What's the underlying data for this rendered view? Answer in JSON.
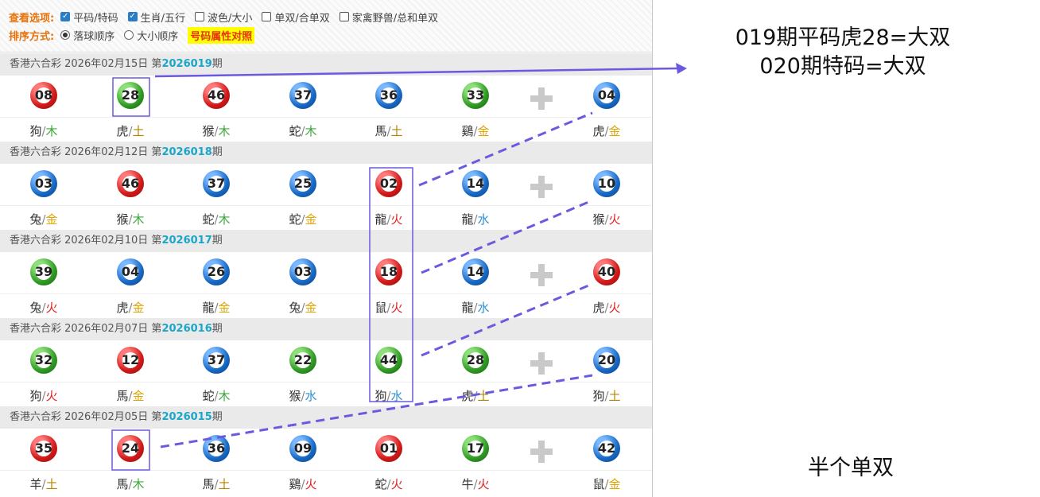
{
  "options": {
    "view_label": "查看选项:",
    "view_items": [
      {
        "label": "平码/特码",
        "checked": true
      },
      {
        "label": "生肖/五行",
        "checked": true
      },
      {
        "label": "波色/大小",
        "checked": false
      },
      {
        "label": "单双/合单双",
        "checked": false
      },
      {
        "label": "家禽野兽/总和单双",
        "checked": false
      }
    ],
    "sort_label": "排序方式:",
    "sort_items": [
      {
        "label": "落球顺序",
        "selected": true
      },
      {
        "label": "大小顺序",
        "selected": false
      }
    ],
    "attr_button": "号码属性对照"
  },
  "draws": [
    {
      "prefix": "香港六合彩 2026年02月15日 第",
      "issue": "2026019",
      "suffix": "期",
      "balls": [
        {
          "num": "08",
          "color": "red",
          "zodiac": "狗",
          "element": "木"
        },
        {
          "num": "28",
          "color": "green",
          "zodiac": "虎",
          "element": "土"
        },
        {
          "num": "46",
          "color": "red",
          "zodiac": "猴",
          "element": "木"
        },
        {
          "num": "37",
          "color": "blue",
          "zodiac": "蛇",
          "element": "木"
        },
        {
          "num": "36",
          "color": "blue",
          "zodiac": "馬",
          "element": "土"
        },
        {
          "num": "33",
          "color": "green",
          "zodiac": "鷄",
          "element": "金"
        },
        {
          "num": "04",
          "color": "blue",
          "zodiac": "虎",
          "element": "金"
        }
      ]
    },
    {
      "prefix": "香港六合彩 2026年02月12日 第",
      "issue": "2026018",
      "suffix": "期",
      "balls": [
        {
          "num": "03",
          "color": "blue",
          "zodiac": "兔",
          "element": "金"
        },
        {
          "num": "46",
          "color": "red",
          "zodiac": "猴",
          "element": "木"
        },
        {
          "num": "37",
          "color": "blue",
          "zodiac": "蛇",
          "element": "木"
        },
        {
          "num": "25",
          "color": "blue",
          "zodiac": "蛇",
          "element": "金"
        },
        {
          "num": "02",
          "color": "red",
          "zodiac": "龍",
          "element": "火"
        },
        {
          "num": "14",
          "color": "blue",
          "zodiac": "龍",
          "element": "水"
        },
        {
          "num": "10",
          "color": "blue",
          "zodiac": "猴",
          "element": "火"
        }
      ]
    },
    {
      "prefix": "香港六合彩 2026年02月10日 第",
      "issue": "2026017",
      "suffix": "期",
      "balls": [
        {
          "num": "39",
          "color": "green",
          "zodiac": "兔",
          "element": "火"
        },
        {
          "num": "04",
          "color": "blue",
          "zodiac": "虎",
          "element": "金"
        },
        {
          "num": "26",
          "color": "blue",
          "zodiac": "龍",
          "element": "金"
        },
        {
          "num": "03",
          "color": "blue",
          "zodiac": "兔",
          "element": "金"
        },
        {
          "num": "18",
          "color": "red",
          "zodiac": "鼠",
          "element": "火"
        },
        {
          "num": "14",
          "color": "blue",
          "zodiac": "龍",
          "element": "水"
        },
        {
          "num": "40",
          "color": "red",
          "zodiac": "虎",
          "element": "火"
        }
      ]
    },
    {
      "prefix": "香港六合彩 2026年02月07日 第",
      "issue": "2026016",
      "suffix": "期",
      "balls": [
        {
          "num": "32",
          "color": "green",
          "zodiac": "狗",
          "element": "火"
        },
        {
          "num": "12",
          "color": "red",
          "zodiac": "馬",
          "element": "金"
        },
        {
          "num": "37",
          "color": "blue",
          "zodiac": "蛇",
          "element": "木"
        },
        {
          "num": "22",
          "color": "green",
          "zodiac": "猴",
          "element": "水"
        },
        {
          "num": "44",
          "color": "green",
          "zodiac": "狗",
          "element": "水"
        },
        {
          "num": "28",
          "color": "green",
          "zodiac": "虎",
          "element": "土"
        },
        {
          "num": "20",
          "color": "blue",
          "zodiac": "狗",
          "element": "土"
        }
      ]
    },
    {
      "prefix": "香港六合彩 2026年02月05日 第",
      "issue": "2026015",
      "suffix": "期",
      "balls": [
        {
          "num": "35",
          "color": "red",
          "zodiac": "羊",
          "element": "土"
        },
        {
          "num": "24",
          "color": "red",
          "zodiac": "馬",
          "element": "木"
        },
        {
          "num": "36",
          "color": "blue",
          "zodiac": "馬",
          "element": "土"
        },
        {
          "num": "09",
          "color": "blue",
          "zodiac": "鷄",
          "element": "火"
        },
        {
          "num": "01",
          "color": "red",
          "zodiac": "蛇",
          "element": "火"
        },
        {
          "num": "17",
          "color": "green",
          "zodiac": "牛",
          "element": "火"
        },
        {
          "num": "42",
          "color": "blue",
          "zodiac": "鼠",
          "element": "金"
        }
      ]
    }
  ],
  "annotations": {
    "note_line1": "019期平码虎28=大双",
    "note_line2": "020期特码=大双",
    "note_bottom": "半个单双"
  },
  "colors": {
    "accent": "#e8720c",
    "issue": "#1aa6c8",
    "annotation": "#6a5ae0"
  }
}
